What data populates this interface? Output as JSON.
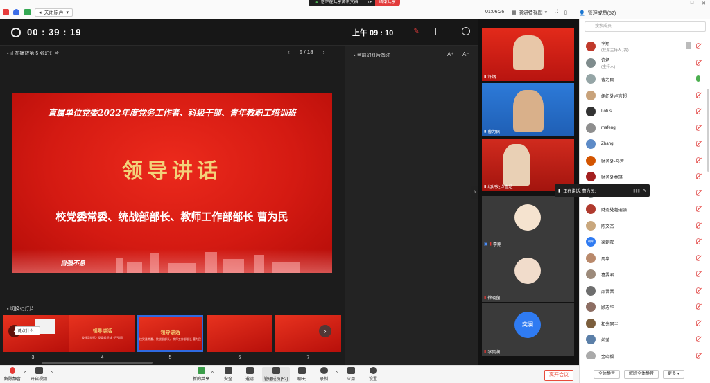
{
  "topbar": {
    "speaker_mode": "关闭原声",
    "share_status": "您正在共享腾讯文档",
    "end_share": "结束共享",
    "timer": "01:06:26",
    "view_mode": "演讲者视图",
    "panel_title": "管理成员(52)"
  },
  "presenter": {
    "elapsed": "00 : 39 : 19",
    "clock": "上午 09 : 10",
    "playing_label": "正在播放第 5 张幻灯片",
    "page_indicator": "5 / 18",
    "notes_label": "当前幻灯片备注",
    "font_up": "A⁺",
    "font_down": "A⁻",
    "thumbs_label": "切换幻灯片",
    "tooltip": "说点什么..."
  },
  "slide": {
    "header": "直属单位党委2022年度党务工作者、科级干部、青年教职工培训班",
    "title": "领导讲话",
    "subtitle": "校党委常委、统战部部长、教师工作部部长  曹为民",
    "logo_text": "自强不息"
  },
  "thumbnails": [
    {
      "num": "3",
      "title": "",
      "sub": ""
    },
    {
      "num": "4",
      "title": "领导讲话",
      "sub": "校领导讲话 · 党委组织部 · 严强同"
    },
    {
      "num": "5",
      "title": "领导讲话",
      "sub": "校党委常委、统战部部长、教师工作部部长 曹为民"
    },
    {
      "num": "6",
      "title": "",
      "sub": ""
    },
    {
      "num": "7",
      "title": "",
      "sub": ""
    }
  ],
  "videos": [
    {
      "name": "许炳"
    },
    {
      "name": "曹为民"
    },
    {
      "name": "组织处卢言超"
    },
    {
      "name": "李翔"
    },
    {
      "name": "徐晓茵"
    },
    {
      "name": "李奕澜",
      "avatar_text": "奕澜"
    }
  ],
  "speaking": "正在讲话: 曹为民;",
  "panel": {
    "search_placeholder": "搜索成员",
    "members": [
      {
        "name": "李翔",
        "role": "(联席主持人, 我)",
        "mic": "muted"
      },
      {
        "name": "许炳",
        "role": "(主持人)",
        "mic": "muted"
      },
      {
        "name": "曹为民",
        "role": "",
        "mic": "on"
      },
      {
        "name": "组织处卢言超",
        "role": "",
        "mic": "muted"
      },
      {
        "name": "Lotus",
        "role": "",
        "mic": "muted"
      },
      {
        "name": "mafeng",
        "role": "",
        "mic": "muted"
      },
      {
        "name": "Zhang",
        "role": "",
        "mic": "muted"
      },
      {
        "name": "财务处-马芳",
        "role": "",
        "mic": "muted"
      },
      {
        "name": "财务处林琪",
        "role": "",
        "mic": "muted"
      },
      {
        "name": "",
        "role": "",
        "mic": "muted"
      },
      {
        "name": "财务处赵迪强",
        "role": "",
        "mic": "muted"
      },
      {
        "name": "陈文杰",
        "role": "",
        "mic": "muted"
      },
      {
        "name": "梁朝晖",
        "role": "",
        "mic": "muted",
        "avatar_text": "朝晖"
      },
      {
        "name": "周华",
        "role": "",
        "mic": "muted"
      },
      {
        "name": "喜雯君",
        "role": "",
        "mic": "muted"
      },
      {
        "name": "邵晋晋",
        "role": "",
        "mic": "muted"
      },
      {
        "name": "顾志华",
        "role": "",
        "mic": "muted"
      },
      {
        "name": "和光同尘",
        "role": "",
        "mic": "muted"
      },
      {
        "name": "娇莹",
        "role": "",
        "mic": "muted"
      },
      {
        "name": "金晓毅",
        "role": "",
        "mic": "muted"
      }
    ],
    "mute_all": "全体静音",
    "unmute_all": "解除全体静音",
    "more": "更多 ▾"
  },
  "bottombar": {
    "mute": "解除静音",
    "video": "开启视频",
    "share": "新的共享",
    "security": "安全",
    "invite": "邀请",
    "members": "管理成员(52)",
    "chat": "聊天",
    "record": "录制",
    "apps": "应用",
    "settings": "设置",
    "leave": "离开会议"
  },
  "colors": {
    "slide_red": "#d41a12",
    "title_gold": "#f3d27a",
    "accent_red": "#e23b3b",
    "active_thumb": "#2f6ae0"
  }
}
